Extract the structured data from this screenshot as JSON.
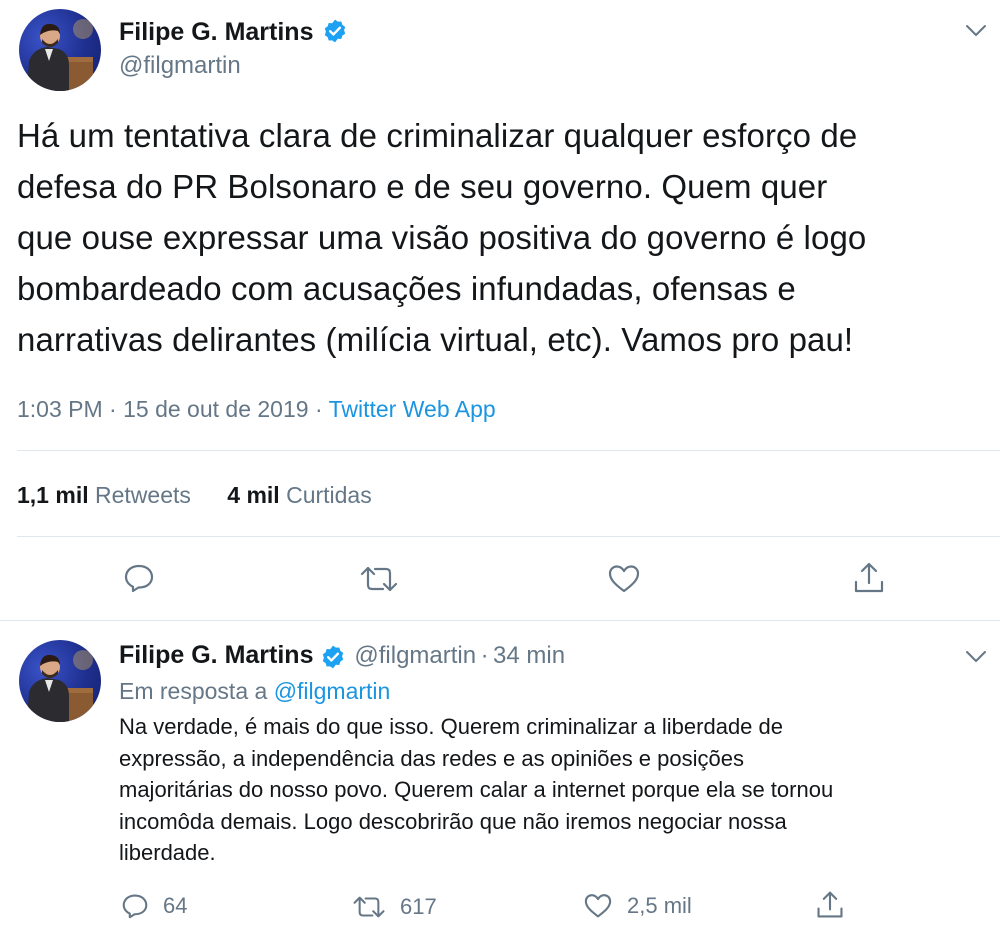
{
  "main_tweet": {
    "author_name": "Filipe G. Martins",
    "author_handle": "@filgmartin",
    "text_lines": [
      "Há um tentativa clara de criminalizar qualquer esforço de",
      "defesa do PR Bolsonaro e de seu governo. Quem quer",
      "que ouse expressar uma visão positiva do governo é logo",
      "bombardeado com acusações infundadas, ofensas e",
      "narrativas delirantes (milícia virtual, etc). Vamos pro pau!"
    ],
    "time": "1:03 PM",
    "date": "15 de out de 2019",
    "separator": "·",
    "source": "Twitter Web App",
    "retweets_count": "1,1 mil",
    "retweets_label": "Retweets",
    "likes_count": "4 mil",
    "likes_label": "Curtidas"
  },
  "reply_tweet": {
    "author_name": "Filipe G. Martins",
    "author_handle": "@filgmartin",
    "separator": "·",
    "time_ago": "34 min",
    "reply_to_label": "Em resposta a",
    "reply_to_handle": "@filgmartin",
    "text_lines": [
      "Na verdade, é mais do que isso. Querem criminalizar a liberdade de",
      "expressão, a independência das redes e as opiniões e posições",
      "majoritárias do nosso povo. Querem calar a internet porque ela se tornou",
      "incomôda demais. Logo descobrirão que não iremos negociar nossa",
      "liberdade."
    ],
    "replies": "64",
    "retweets": "617",
    "likes": "2,5 mil"
  },
  "colors": {
    "text": "#14171a",
    "secondary": "#657786",
    "link": "#1b95e0",
    "verified": "#1da1f2",
    "divider": "#e1e8ed"
  },
  "icons": [
    "verified-badge-icon",
    "chevron-down-icon",
    "reply-icon",
    "retweet-icon",
    "like-icon",
    "share-icon"
  ]
}
